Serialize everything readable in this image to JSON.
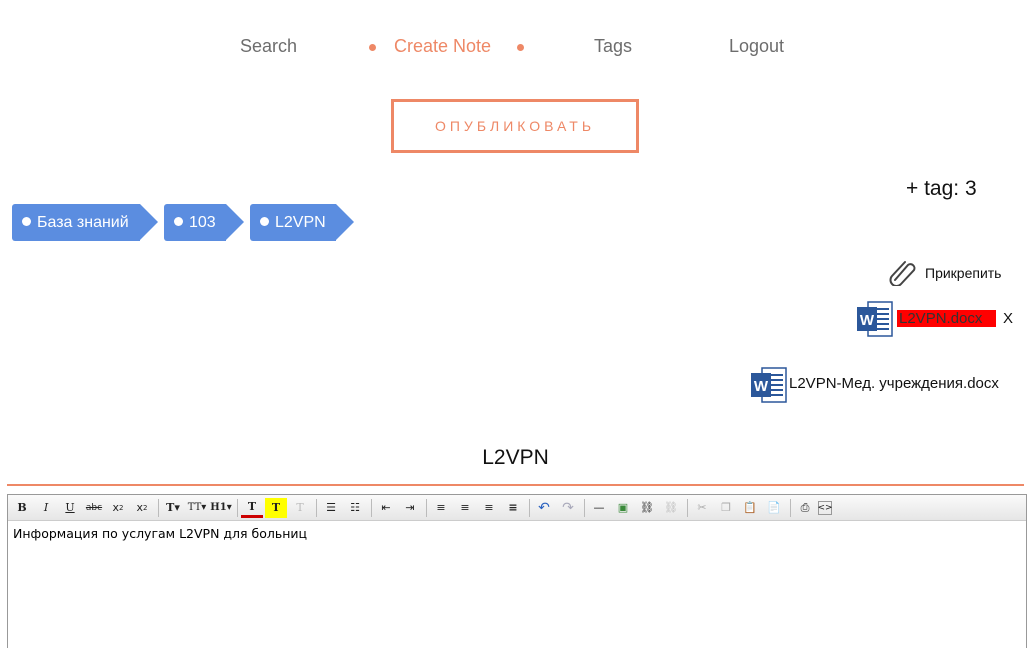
{
  "nav": {
    "search": "Search",
    "create_note": "Create Note",
    "tags": "Tags",
    "logout": "Logout"
  },
  "publish_button": "ОПУБЛИКОВАТЬ",
  "tag_count": "+ tag: 3",
  "breadcrumbs": [
    "База знаний",
    "103",
    "L2VPN"
  ],
  "attach_label": "Прикрепить",
  "attachments": [
    {
      "name": "L2VPN.docx",
      "remove": "X",
      "highlighted": true
    },
    {
      "name": "L2VPN-Мед. учреждения.docx"
    }
  ],
  "note_title": "L2VPN",
  "editor": {
    "content": "Информация по услугам L2VPN для больниц",
    "toolbar_buttons": [
      "bold",
      "italic",
      "underline",
      "strikethrough",
      "subscript",
      "superscript",
      "font-size",
      "font-family",
      "heading",
      "text-color",
      "highlight",
      "clear-format",
      "bullet-list",
      "numbered-list",
      "outdent",
      "indent",
      "align-left",
      "align-center",
      "align-right",
      "justify",
      "undo",
      "redo",
      "horizontal-rule",
      "insert-image",
      "insert-link",
      "unlink",
      "cut",
      "copy",
      "paste",
      "paste-text",
      "print",
      "source"
    ]
  },
  "colors": {
    "accent": "#ee8866",
    "breadcrumb": "#5b8de0",
    "highlight": "#ff0000",
    "word_blue": "#2b579a"
  }
}
